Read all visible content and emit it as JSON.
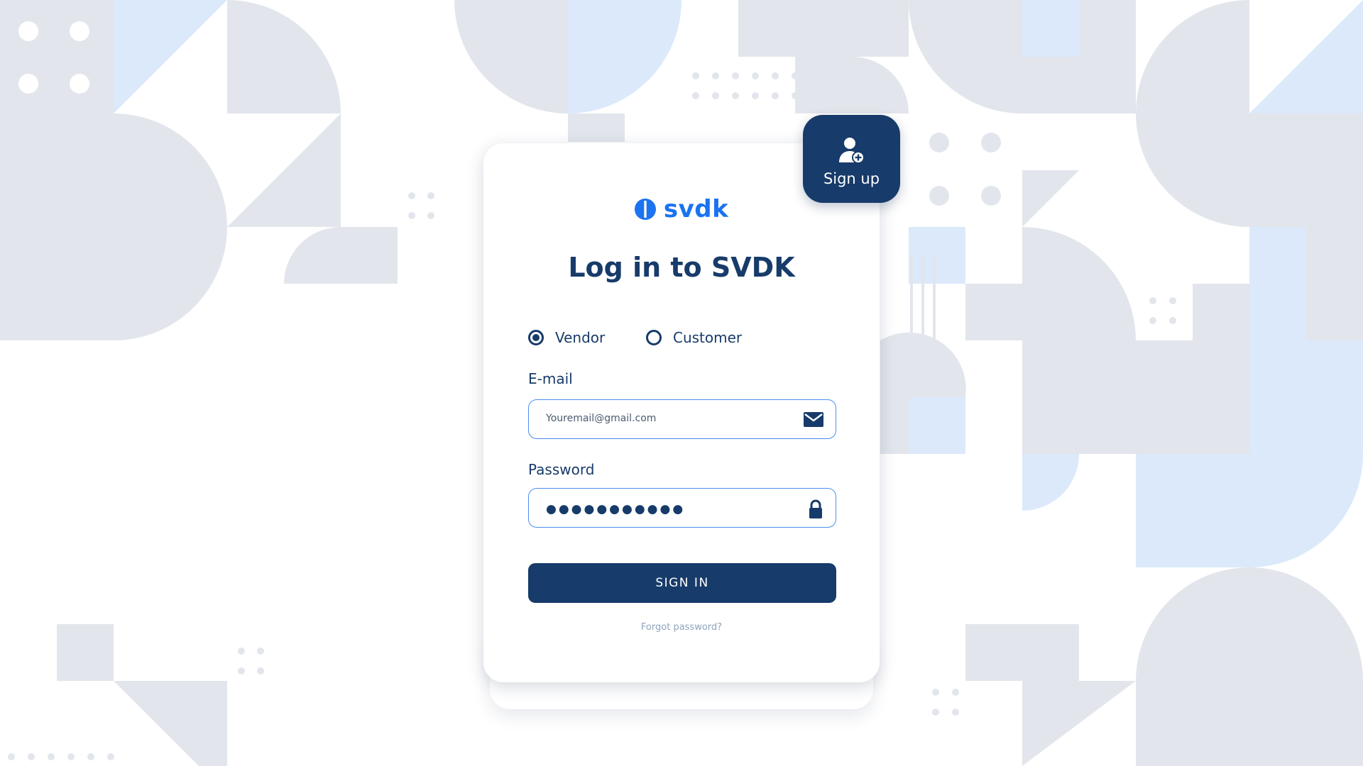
{
  "brand": {
    "logo_text": "svdk",
    "logo_color": "#1a73f0",
    "icon": "svdk-logo-icon"
  },
  "signup": {
    "label": "Sign up",
    "icon": "add-user-icon",
    "bg": "#173b6a"
  },
  "login": {
    "title": "Log in to SVDK",
    "account_types": [
      {
        "label": "Vendor",
        "selected": true
      },
      {
        "label": "Customer",
        "selected": false
      }
    ],
    "email": {
      "label": "E-mail",
      "placeholder": "Youremail@gmail.com",
      "icon": "mail-icon"
    },
    "password": {
      "label": "Password",
      "masked_value": "●●●●●●●●●●●",
      "icon": "lock-icon"
    },
    "submit_label": "SIGN IN",
    "forgot_label": "Forgot password?"
  },
  "colors": {
    "primary": "#173b6a",
    "accent": "#1a73f0",
    "field_border": "#4a8ef0",
    "bg_shape": "#e1e5ec",
    "bg_shape_light": "#dbe9fb"
  }
}
